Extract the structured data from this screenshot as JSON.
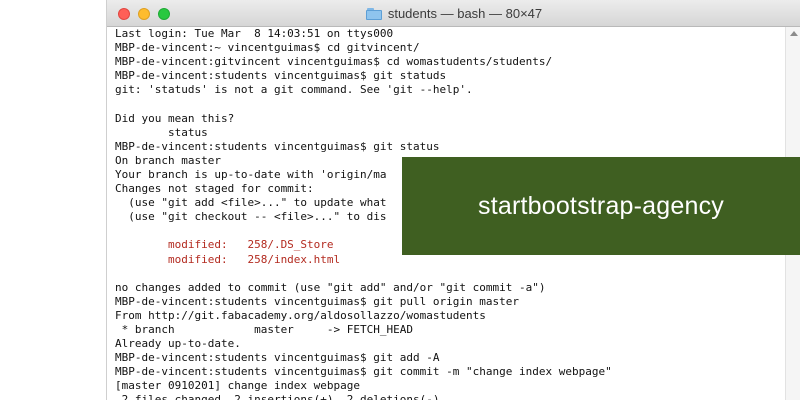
{
  "window": {
    "title": "students — bash — 80×47",
    "title_icon": "folder-icon",
    "traffic_lights": {
      "close_color": "#ff5f57",
      "minimize_color": "#febc2e",
      "zoom_color": "#28c840"
    }
  },
  "terminal": {
    "lines": [
      {
        "text": "Last login: Tue Mar  8 14:03:51 on ttys000",
        "kind": "normal"
      },
      {
        "text": "MBP-de-vincent:~ vincentguimas$ cd gitvincent/",
        "kind": "normal"
      },
      {
        "text": "MBP-de-vincent:gitvincent vincentguimas$ cd womastudents/students/",
        "kind": "normal"
      },
      {
        "text": "MBP-de-vincent:students vincentguimas$ git statuds",
        "kind": "normal"
      },
      {
        "text": "git: 'statuds' is not a git command. See 'git --help'.",
        "kind": "normal"
      },
      {
        "text": "",
        "kind": "normal"
      },
      {
        "text": "Did you mean this?",
        "kind": "normal"
      },
      {
        "text": "        status",
        "kind": "normal"
      },
      {
        "text": "MBP-de-vincent:students vincentguimas$ git status",
        "kind": "normal"
      },
      {
        "text": "On branch master",
        "kind": "normal"
      },
      {
        "text": "Your branch is up-to-date with 'origin/ma",
        "kind": "normal"
      },
      {
        "text": "Changes not staged for commit:",
        "kind": "normal"
      },
      {
        "text": "  (use \"git add <file>...\" to update what",
        "kind": "normal"
      },
      {
        "text": "  (use \"git checkout -- <file>...\" to dis",
        "kind": "normal"
      },
      {
        "text": "",
        "kind": "normal"
      },
      {
        "text": "        modified:   258/.DS_Store",
        "kind": "modified"
      },
      {
        "text": "        modified:   258/index.html",
        "kind": "modified"
      },
      {
        "text": "",
        "kind": "normal"
      },
      {
        "text": "no changes added to commit (use \"git add\" and/or \"git commit -a\")",
        "kind": "normal"
      },
      {
        "text": "MBP-de-vincent:students vincentguimas$ git pull origin master",
        "kind": "normal"
      },
      {
        "text": "From http://git.fabacademy.org/aldosollazzo/womastudents",
        "kind": "normal"
      },
      {
        "text": " * branch            master     -> FETCH_HEAD",
        "kind": "normal"
      },
      {
        "text": "Already up-to-date.",
        "kind": "normal"
      },
      {
        "text": "MBP-de-vincent:students vincentguimas$ git add -A",
        "kind": "normal"
      },
      {
        "text": "MBP-de-vincent:students vincentguimas$ git commit -m \"change index webpage\"",
        "kind": "normal"
      },
      {
        "text": "[master 0910201] change index webpage",
        "kind": "normal"
      },
      {
        "text": " 2 files changed, 2 insertions(+), 2 deletions(-)",
        "kind": "normal"
      }
    ],
    "colors": {
      "text": "#111111",
      "modified": "#b32b20",
      "background": "#ffffff"
    }
  },
  "banner": {
    "text": "startbootstrap-agency",
    "background": "#3f5f21",
    "text_color": "#ffffff"
  },
  "scrollbar": {
    "icon": "scroll-up-arrow-icon"
  }
}
